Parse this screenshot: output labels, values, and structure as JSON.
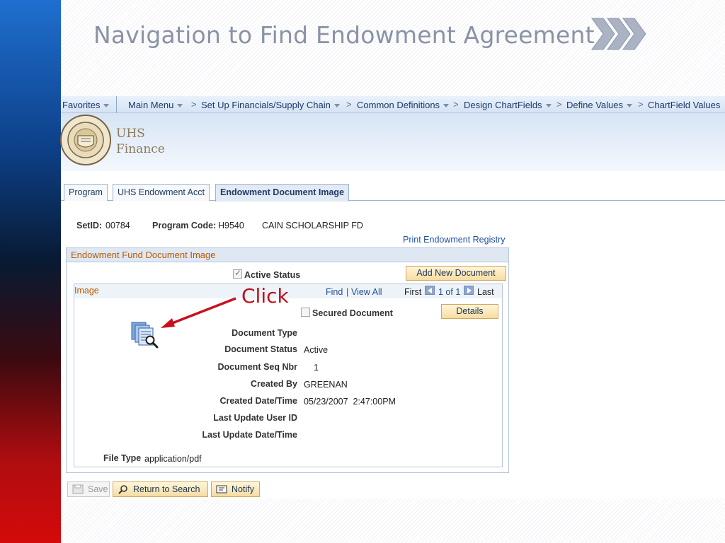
{
  "slide": {
    "title": "Navigation to Find Endowment Agreement"
  },
  "nav": {
    "favorites": "Favorites",
    "main_menu": "Main Menu",
    "crumbs": [
      "Set Up Financials/Supply Chain",
      "Common Definitions",
      "Design ChartFields",
      "Define Values",
      "ChartField Values"
    ]
  },
  "logo": {
    "line1": "UHS",
    "line2": "Finance",
    "seal_text": "UNIVERSITY OF HOUSTON SYSTEM"
  },
  "tabs": [
    {
      "label": "Program",
      "active": false
    },
    {
      "label": "UHS Endowment Acct",
      "active": false
    },
    {
      "label": "Endowment Document Image",
      "active": true
    }
  ],
  "header_fields": {
    "setid_label": "SetID:",
    "setid_value": "00784",
    "program_code_label": "Program Code:",
    "program_code_value": "H9540",
    "program_desc": "CAIN SCHOLARSHIP FD",
    "print_link": "Print Endowment Registry"
  },
  "fund_section": {
    "title": "Endowment Fund Document Image",
    "active_status_label": "Active Status",
    "active_status_checked": true,
    "add_button": "Add New Document"
  },
  "image_section": {
    "title": "Image",
    "find": "Find",
    "sep": "|",
    "view_all": "View All",
    "first": "First",
    "page_info": "1 of 1",
    "last": "Last",
    "secured_label": "Secured Document",
    "secured_checked": false,
    "details_button": "Details",
    "annotation": "Click"
  },
  "details": {
    "document_type_label": "Document Type",
    "document_type_value": "",
    "document_status_label": "Document Status",
    "document_status_value": "Active",
    "seq_nbr_label": "Document Seq Nbr",
    "seq_nbr_value": "1",
    "created_by_label": "Created By",
    "created_by_value": "GREENAN",
    "created_dt_label": "Created Date/Time",
    "created_dt_value": "05/23/2007  2:47:00PM",
    "last_user_label": "Last Update User ID",
    "last_dt_label": "Last Update Date/Time",
    "file_type_label": "File Type",
    "file_type_value": "application/pdf"
  },
  "footer": {
    "save": "Save",
    "return": "Return to Search",
    "notify": "Notify"
  },
  "colors": {
    "title": "#8a93a6",
    "annotation": "#c0101a",
    "section_header": "#b75a00",
    "link": "#1d4e9a"
  }
}
